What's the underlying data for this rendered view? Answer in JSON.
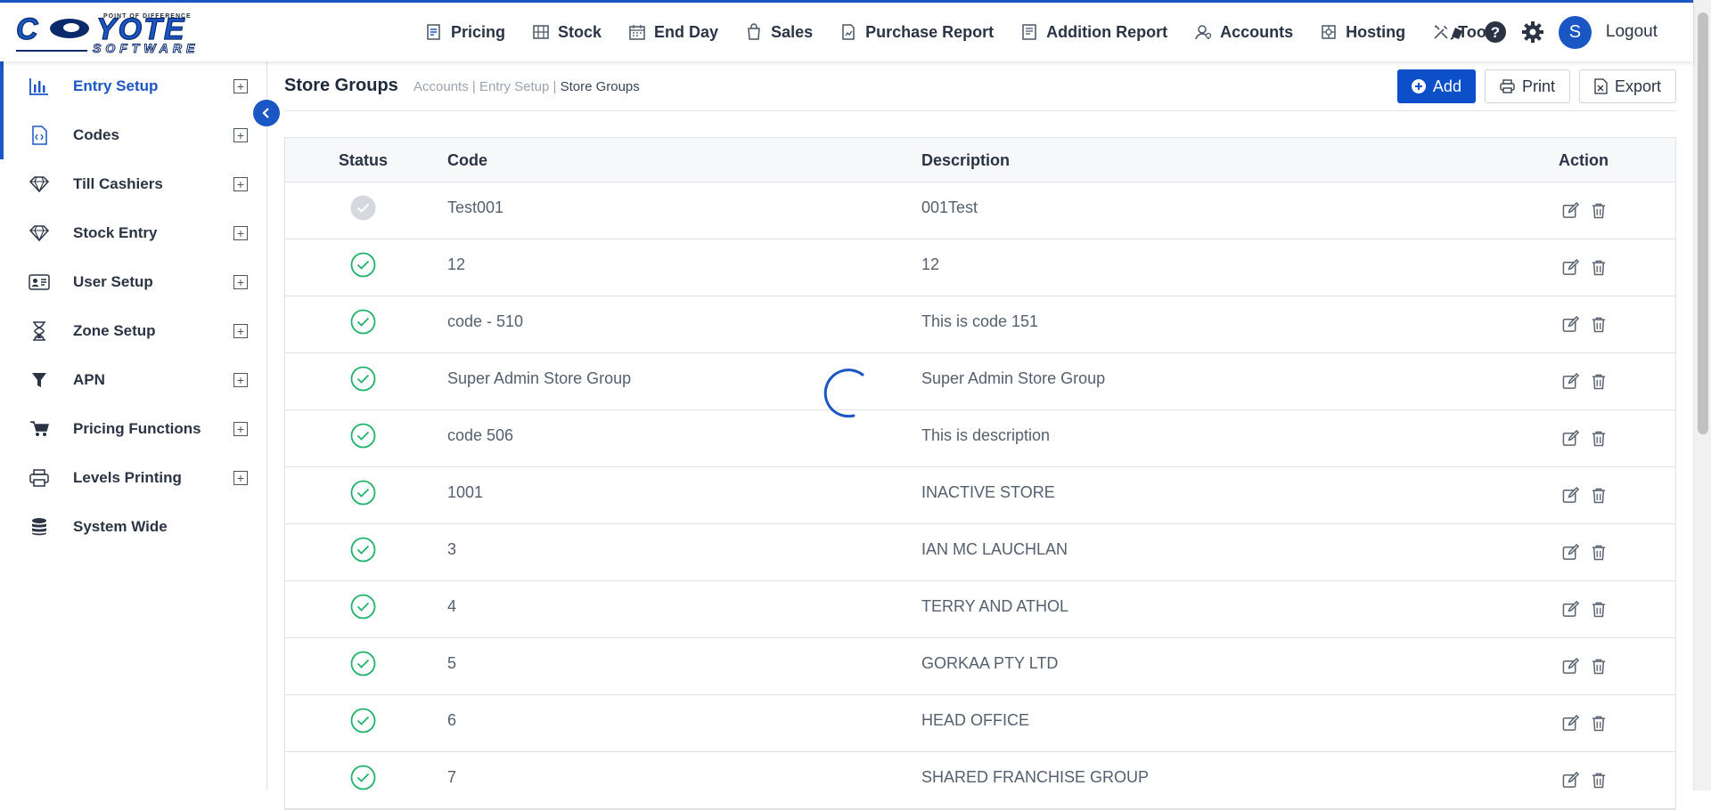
{
  "brand": {
    "name": "COYOTE",
    "sub": "SOFTWARE",
    "tagline": "POINT OF DIFFERENCE",
    "color": "#1a56c4"
  },
  "topnav": {
    "items": [
      {
        "label": "Pricing",
        "icon": "pricing-icon"
      },
      {
        "label": "Stock",
        "icon": "stock-icon"
      },
      {
        "label": "End Day",
        "icon": "calendar-icon"
      },
      {
        "label": "Sales",
        "icon": "sales-bag-icon"
      },
      {
        "label": "Purchase Report",
        "icon": "purchase-report-icon"
      },
      {
        "label": "Addition Report",
        "icon": "addition-report-icon"
      },
      {
        "label": "Accounts",
        "icon": "accounts-icon"
      },
      {
        "label": "Hosting",
        "icon": "hosting-icon"
      },
      {
        "label": "Tools",
        "icon": "tools-icon"
      }
    ],
    "avatar_letter": "S",
    "logout": "Logout"
  },
  "sidebar": {
    "items": [
      {
        "label": "Entry Setup",
        "icon": "bar-chart-icon",
        "expandable": true,
        "active": true
      },
      {
        "label": "Codes",
        "icon": "code-file-icon",
        "expandable": true
      },
      {
        "label": "Till Cashiers",
        "icon": "diamond-icon",
        "expandable": true
      },
      {
        "label": "Stock Entry",
        "icon": "diamond-icon",
        "expandable": true
      },
      {
        "label": "User Setup",
        "icon": "id-card-icon",
        "expandable": true
      },
      {
        "label": "Zone Setup",
        "icon": "hourglass-icon",
        "expandable": true
      },
      {
        "label": "APN",
        "icon": "filter-icon",
        "expandable": true
      },
      {
        "label": "Pricing Functions",
        "icon": "cart-icon",
        "expandable": true
      },
      {
        "label": "Levels Printing",
        "icon": "printer-icon",
        "expandable": true
      },
      {
        "label": "System Wide",
        "icon": "database-icon",
        "expandable": false
      }
    ]
  },
  "page": {
    "title": "Store Groups",
    "breadcrumb": [
      "Accounts",
      "Entry Setup",
      "Store Groups"
    ],
    "breadcrumb_sep": " | ",
    "add_label": "Add",
    "print_label": "Print",
    "export_label": "Export"
  },
  "table": {
    "headers": {
      "status": "Status",
      "code": "Code",
      "description": "Description",
      "action": "Action"
    },
    "rows": [
      {
        "active": false,
        "code": "Test001",
        "description": "001Test"
      },
      {
        "active": true,
        "code": "12",
        "description": "12"
      },
      {
        "active": true,
        "code": "code - 510",
        "description": "This is code 151"
      },
      {
        "active": true,
        "code": "Super Admin Store Group",
        "description": "Super Admin Store Group"
      },
      {
        "active": true,
        "code": "code 506",
        "description": "This is description"
      },
      {
        "active": true,
        "code": "1001",
        "description": "INACTIVE STORE"
      },
      {
        "active": true,
        "code": "3",
        "description": "IAN MC LAUCHLAN"
      },
      {
        "active": true,
        "code": "4",
        "description": "TERRY AND ATHOL"
      },
      {
        "active": true,
        "code": "5",
        "description": "GORKAA PTY LTD"
      },
      {
        "active": true,
        "code": "6",
        "description": "HEAD OFFICE"
      },
      {
        "active": true,
        "code": "7",
        "description": "SHARED FRANCHISE GROUP"
      }
    ]
  },
  "colors": {
    "accent": "#1a56c4",
    "active_status": "#20b36b",
    "inactive_status": "#d5d8dd"
  }
}
